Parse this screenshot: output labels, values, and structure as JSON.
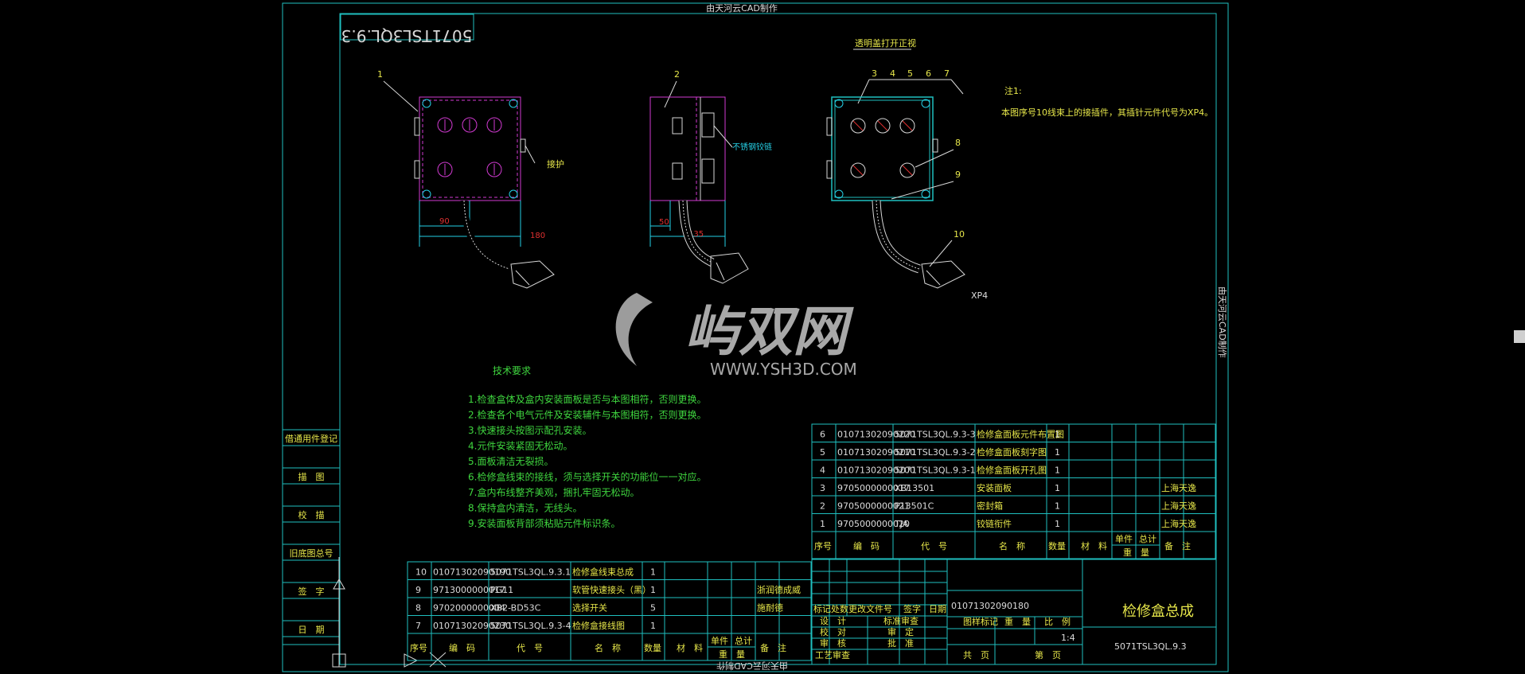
{
  "watermark": {
    "brand": "ysh3d",
    "cn": "屿双网",
    "url": "WWW.YSH3D.COM"
  },
  "frame": {
    "top_caption": "由天河云CAD制作",
    "bottom_caption": "由天河云CAD制作",
    "right_caption": "由天河云CAD制作",
    "corner_code": "5071TSL3QL.9.3"
  },
  "views": {
    "front_title": "透明盖打开正视",
    "balloons": [
      "1",
      "2",
      "3",
      "4",
      "5",
      "6",
      "7",
      "8",
      "9",
      "10"
    ],
    "callout_pz": "接护",
    "callout_side": "不锈钢铰链",
    "dims": {
      "d90": "90",
      "d180": "180",
      "d50": "50",
      "d135": "135"
    },
    "plug_label": "XP4"
  },
  "note": {
    "title": "注1:",
    "text": "本图序号10线束上的接插件，其插针元件代号为XP4。"
  },
  "tech": {
    "title": "技术要求",
    "items": [
      "1.检查盒体及盒内安装面板是否与本图相符，否则更换。",
      "2.检查各个电气元件及安装辅件与本图相符，否则更换。",
      "3.快速接头按图示配孔安装。",
      "4.元件安装紧固无松动。",
      "5.面板清洁无裂损。",
      "6.检修盒线束的接线，须与选择开关的功能位一一对应。",
      "7.盒内布线整齐美观，捆扎牢固无松动。",
      "8.保持盒内清洁，无线头。",
      "9.安装面板背部须粘贴元件标识条。"
    ]
  },
  "left_block": [
    "借通用件登记",
    "描　图",
    "校　描",
    "旧底图总号",
    "签　字",
    "日　期"
  ],
  "bom_upper": {
    "rows": [
      {
        "no": "6",
        "code": "01071302090220",
        "drawing": "5071TSL3QL.9.3-3",
        "name": "检修盒面板元件布置图",
        "qty": "1",
        "remark": ""
      },
      {
        "no": "5",
        "code": "01071302090210",
        "drawing": "5071TSL3QL.9.3-2",
        "name": "检修盒面板刻字图",
        "qty": "1",
        "remark": ""
      },
      {
        "no": "4",
        "code": "01071302090200",
        "drawing": "5071TSL3QL.9.3-1",
        "name": "检修盒面板开孔图",
        "qty": "1",
        "remark": ""
      },
      {
        "no": "3",
        "code": "9705000000017",
        "drawing": "XB13501",
        "name": "安装面板",
        "qty": "1",
        "remark": "上海天逸"
      },
      {
        "no": "2",
        "code": "9705000000021",
        "drawing": "P13501C",
        "name": "密封箱",
        "qty": "1",
        "remark": "上海天逸"
      },
      {
        "no": "1",
        "code": "9705000000020",
        "drawing": "TJA",
        "name": "铰链衔件",
        "qty": "1",
        "remark": "上海天逸"
      }
    ],
    "header": {
      "no": "序号",
      "code": "编　码",
      "drawing": "代　号",
      "name": "名　称",
      "qty": "数量",
      "material": "材　料",
      "unit": "单件",
      "total": "总计",
      "weight": "重　量",
      "remark": "备　注"
    }
  },
  "bom_lower": {
    "rows": [
      {
        "no": "10",
        "code": "01071302090190",
        "drawing": "5071TSL3QL.9.3.1",
        "name": "检修盒线束总成",
        "qty": "1",
        "remark": ""
      },
      {
        "no": "9",
        "code": "9713000000017",
        "drawing": "PG11",
        "name": "软管快速接头（黑）",
        "qty": "1",
        "remark": "浙润德成威"
      },
      {
        "no": "8",
        "code": "9702000000004",
        "drawing": "XB2-BD53C",
        "name": "选择开关",
        "qty": "5",
        "remark": "施耐德"
      },
      {
        "no": "7",
        "code": "01071302090230",
        "drawing": "5071TSL3QL.9.3-4",
        "name": "检修盒接线图",
        "qty": "1",
        "remark": ""
      }
    ],
    "header": {
      "no": "序号",
      "code": "编　码",
      "drawing": "代　号",
      "name": "名　称",
      "qty": "数量",
      "material": "材　料",
      "unit": "单件",
      "total": "总计",
      "weight": "重　量",
      "remark": "备　注"
    }
  },
  "title_block": {
    "drawing_code": "01071302090180",
    "title": "检修盒总成",
    "drawing_no": "5071TSL3QL.9.3",
    "labels": [
      "标记",
      "处数",
      "更改文件号",
      "签字",
      "日期"
    ],
    "roles": [
      "设　计",
      "校　对",
      "审　核",
      "工艺审查"
    ],
    "roles2": [
      "标准审查",
      "审　定",
      "批　准"
    ],
    "stage_label": "图样标记",
    "weight_label": "重　量",
    "scale_label": "比　例",
    "scale": "1:4",
    "sheet": "共　页",
    "page": "第　页"
  }
}
